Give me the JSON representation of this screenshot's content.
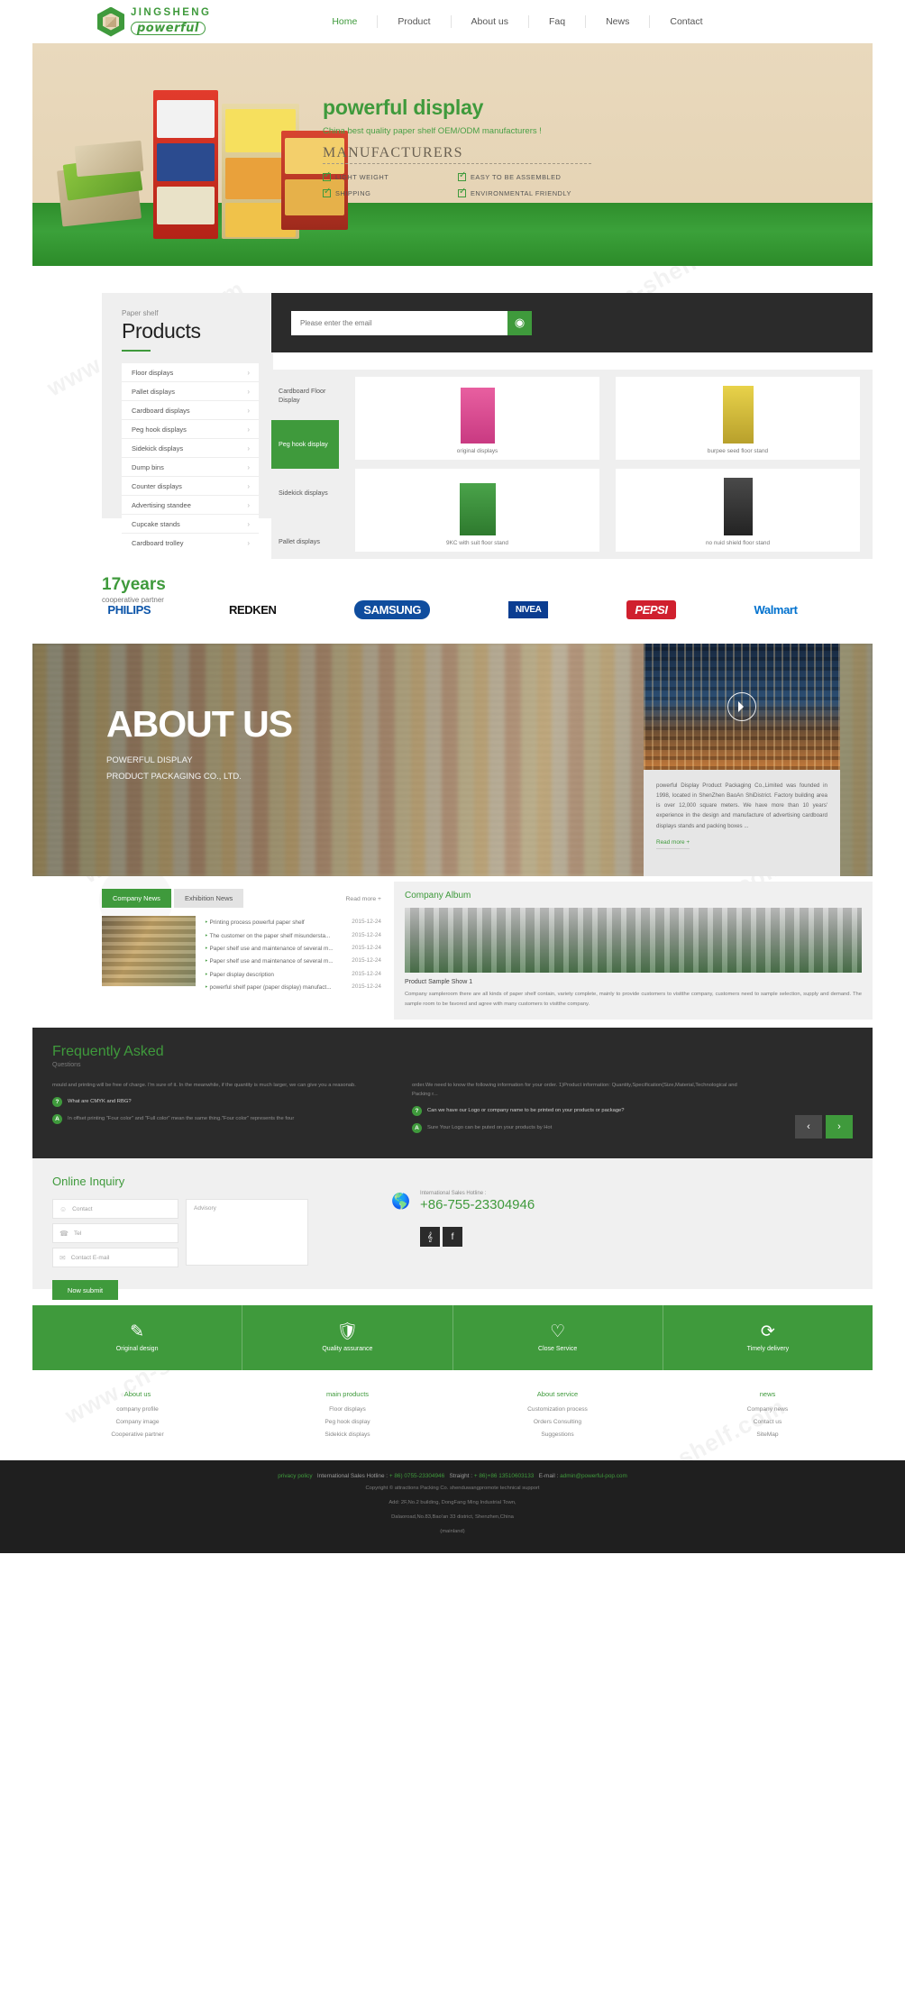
{
  "header": {
    "logo": {
      "name": "JINGSHENG",
      "sub": "powerful"
    },
    "nav": [
      {
        "label": "Home",
        "active": true
      },
      {
        "label": "Product"
      },
      {
        "label": "About us"
      },
      {
        "label": "Faq"
      },
      {
        "label": "News"
      },
      {
        "label": "Contact"
      }
    ]
  },
  "hero": {
    "title": "powerful display",
    "subtitle": "China best quality paper shelf OEM/ODM manufacturers !",
    "manufacturers": "MANUFACTURERS",
    "features": [
      "LIGHT WEIGHT",
      "EASY TO BE ASSEMBLED",
      "SHIPPING",
      "ENVIRONMENTAL FRIENDLY"
    ]
  },
  "products": {
    "kicker": "Paper shelf",
    "title": "Products",
    "categories": [
      "Floor displays",
      "Pallet displays",
      "Cardboard displays",
      "Peg hook displays",
      "Sidekick displays",
      "Dump bins",
      "Counter displays",
      "Advertising standee",
      "Cupcake stands",
      "Cardboard trolley"
    ],
    "newsletter": {
      "placeholder": "Please enter the email",
      "icon": "rss-icon"
    },
    "tabs": [
      {
        "label": "Cardboard Floor Display",
        "active": false
      },
      {
        "label": "Peg hook display",
        "active": true
      },
      {
        "label": "Sidekick displays",
        "active": false
      },
      {
        "label": "Pallet displays",
        "active": false
      }
    ],
    "items": [
      {
        "caption": "original displays"
      },
      {
        "caption": "burpee seed floor stand"
      },
      {
        "caption": "9KC with suit floor stand"
      },
      {
        "caption": "no nuid shield floor stand"
      }
    ]
  },
  "partners": {
    "years": "17years",
    "years_sub": "cooperative partner",
    "brands": [
      "PHILIPS",
      "REDKEN",
      "SAMSUNG",
      "NIVEA",
      "PEPSI",
      "Walmart"
    ]
  },
  "about": {
    "title": "ABOUT US",
    "line1": "POWERFUL DISPLAY",
    "line2": "PRODUCT PACKAGING CO., LTD.",
    "card_text": "powerful Display Product Packaging Co.,Limited  was founded in 1998, located in ShenZhen BaoAn ShiDistrict. Factory building area is over 12,000 square meters. We have more than 10 years' experience in the design and manufacture of advertising cardboard displays stands and packing boxes ...",
    "read_more": "Read more +",
    "play": "play-icon"
  },
  "news": {
    "tabs": [
      {
        "label": "Company News",
        "active": true
      },
      {
        "label": "Exhibition News",
        "active": false
      }
    ],
    "more": "Read more +",
    "items": [
      {
        "title": "Printing process powerful paper shelf",
        "date": "2015-12-24"
      },
      {
        "title": "The customer on the paper shelf misundersta...",
        "date": "2015-12-24"
      },
      {
        "title": "Paper shelf use and maintenance of several m...",
        "date": "2015-12-24"
      },
      {
        "title": "Paper shelf use and maintenance of several m...",
        "date": "2015-12-24"
      },
      {
        "title": "Paper display description",
        "date": "2015-12-24"
      },
      {
        "title": "powerful shelf paper (paper display) manufact...",
        "date": "2015-12-24"
      }
    ]
  },
  "album": {
    "title": "Company Album",
    "caption": "Product Sample Show 1",
    "text": "Company sampleroom there are all kinds of paper shelf contain, variety complete, mainly to provide customers to visitthe company, customers need to sample selection, supply and demand. The sample room to be favored and agree with many customers to visitthe company."
  },
  "faq": {
    "title": "Frequently Asked",
    "subtitle": "Questions",
    "left": [
      {
        "q": "",
        "a": "mould and printing will be free of charge. I'm sure of it.        In the meanwhile, if the quantity is much larger, we can give you a reasonab."
      },
      {
        "q": "What are CMYK and RBG?",
        "a": "In offset printing \"Four color\" and \"Full color\" mean the same thing.\"Four color\" represents the four"
      }
    ],
    "right": [
      {
        "a": "order.We need to know the following information for your order.      1)Product information: Quantity,Specification(Size,Material,Technological and Packing r..."
      },
      {
        "q": "Can we have our Logo or company name to be printed on your products or package?"
      },
      {
        "q": "Sure Your Logo can be puted on your products by Hot"
      }
    ],
    "nav_prev": "‹",
    "nav_next": "›"
  },
  "inquiry": {
    "title": "Online Inquiry",
    "fields": [
      {
        "icon": "user-icon",
        "placeholder": "Contact"
      },
      {
        "icon": "phone-icon",
        "placeholder": "Tel"
      },
      {
        "icon": "mail-icon",
        "placeholder": "Contact E-mail"
      }
    ],
    "textarea_placeholder": "Advisory",
    "submit": "Now submit",
    "hotline_label": "International Sales Hotline :",
    "hotline": "+86-755-23304946",
    "socials": [
      "twitter-icon",
      "facebook-icon"
    ]
  },
  "services": [
    {
      "icon": "pencil-icon",
      "label": "Original design"
    },
    {
      "icon": "shield-icon",
      "label": "Quality assurance"
    },
    {
      "icon": "heart-check-icon",
      "label": "Close Service"
    },
    {
      "icon": "refresh-icon",
      "label": "Timely delivery"
    }
  ],
  "footer": {
    "columns": [
      {
        "title": "About us",
        "links": [
          "company profile",
          "Company image",
          "Cooperative partner"
        ]
      },
      {
        "title": "main products",
        "links": [
          "Floor displays",
          "Peg hook display",
          "Sidekick displays"
        ]
      },
      {
        "title": "About service",
        "links": [
          "Customization process",
          "Orders Consulting",
          "Suggestions"
        ]
      },
      {
        "title": "news",
        "links": [
          "Company news",
          "Contact us",
          "SiteMap"
        ]
      }
    ],
    "bottom": {
      "privacy": "privacy policy",
      "hotline_label": "International Sales Hotline :",
      "hotline": "+ 86) 0755-23304946",
      "straight_label": "Straight :",
      "straight": "+ 86)+86 13510603133",
      "email_label": "E-mail :",
      "email": "admin@powerful-pop.com",
      "copyright": "Copyright © attractions Packing Co. shenduwangpromote technical support",
      "address1": "Add: 2F,No.2 building, DongFang Ming Industrial Town,",
      "address2": "Dalaoroad,No.83,Bao'an 33 district, Shenzhen,China",
      "address3": "(mainland)"
    }
  }
}
